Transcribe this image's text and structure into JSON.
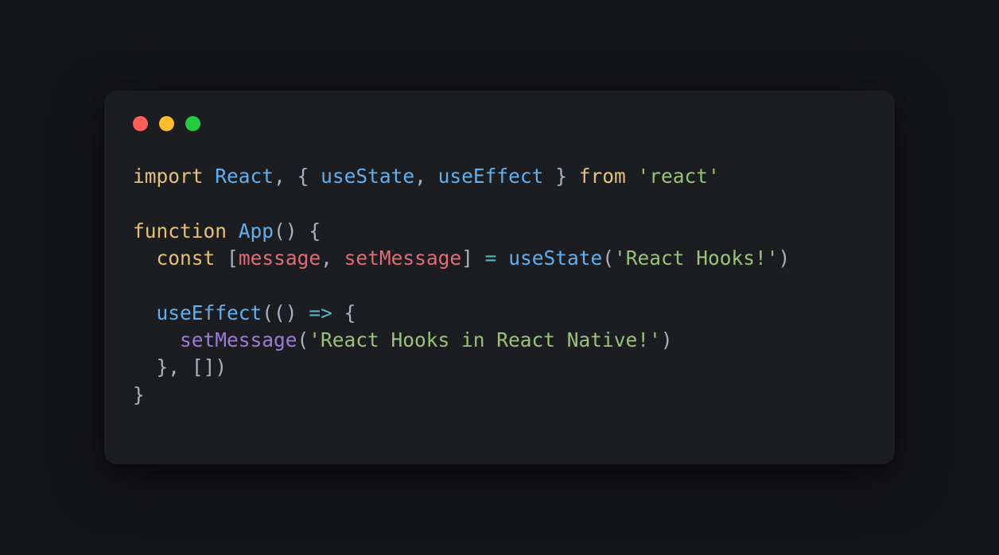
{
  "window": {
    "traffic_lights": [
      "close",
      "minimize",
      "maximize"
    ]
  },
  "code": {
    "line1": {
      "kw_import": "import",
      "react": "React",
      "comma1": ",",
      "lbrace": "{",
      "useState": "useState",
      "comma2": ",",
      "useEffect": "useEffect",
      "rbrace": "}",
      "kw_from": "from",
      "module": "'react'"
    },
    "line3": {
      "kw_function": "function",
      "name": "App",
      "parens": "()",
      "lbrace": "{"
    },
    "line4": {
      "kw_const": "const",
      "lbracket": "[",
      "message": "message",
      "comma": ",",
      "setMessage": "setMessage",
      "rbracket": "]",
      "eq": "=",
      "useState": "useState",
      "lparen": "(",
      "arg": "'React Hooks!'",
      "rparen": ")"
    },
    "line6": {
      "useEffect": "useEffect",
      "lparen": "((",
      "rparen_arrow": ")",
      "arrow": "=>",
      "lbrace": "{"
    },
    "line7": {
      "call": "setMessage",
      "lparen": "(",
      "arg": "'React Hooks in React Native!'",
      "rparen": ")"
    },
    "line8": {
      "rbrace": "}",
      "comma": ",",
      "deps": "[])"
    },
    "line9": {
      "rbrace": "}"
    }
  }
}
